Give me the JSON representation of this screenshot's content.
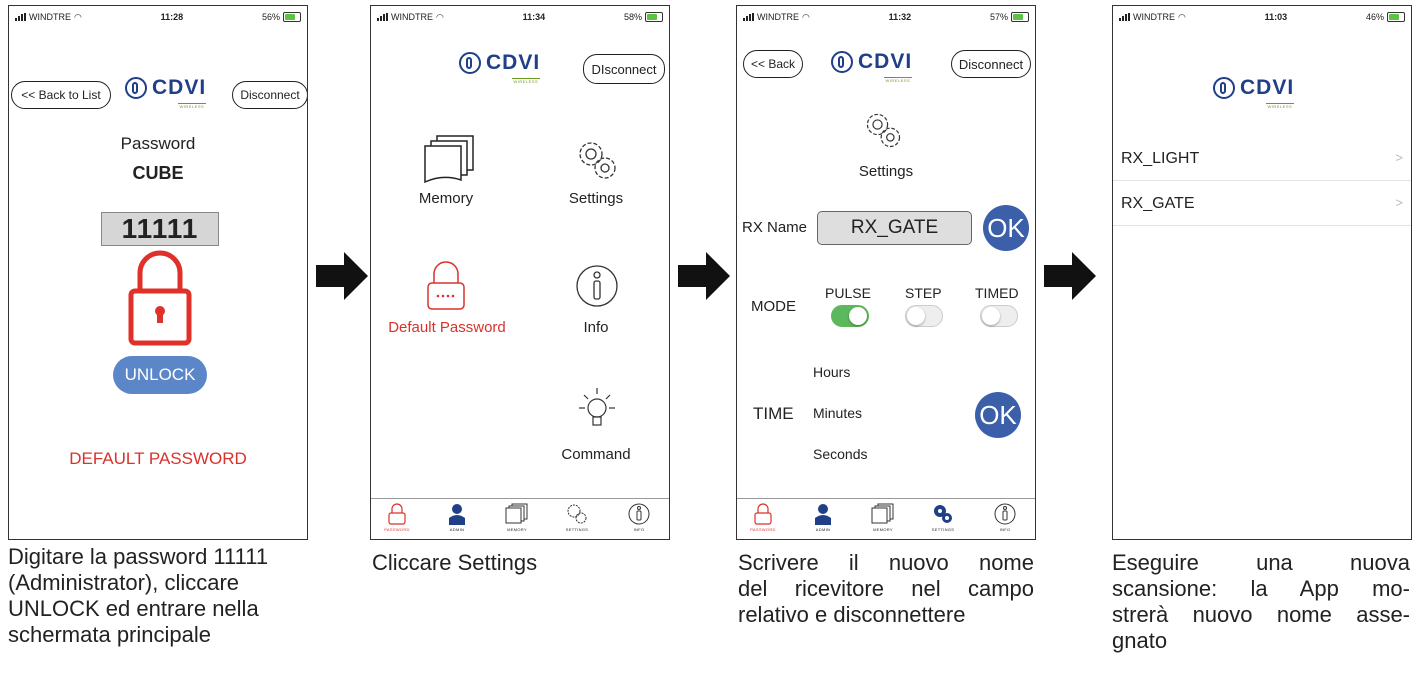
{
  "screen1": {
    "status": {
      "carrier": "WINDTRE",
      "time": "11:28",
      "battery": "56%"
    },
    "back_label": "<< Back to List",
    "disconnect_label": "Disconnect",
    "logo": {
      "name": "CDVI",
      "sub": "WIRELESS"
    },
    "password_label": "Password",
    "device_name": "CUBE",
    "password_value": "11111",
    "unlock_label": "UNLOCK",
    "default_password_label": "DEFAULT PASSWORD",
    "lock_color": "#e0302a"
  },
  "screen2": {
    "status": {
      "carrier": "WINDTRE",
      "time": "11:34",
      "battery": "58%"
    },
    "disconnect_label": "DIsconnect",
    "logo": {
      "name": "CDVI",
      "sub": "WIRELESS"
    },
    "menu": {
      "memory": "Memory",
      "settings": "Settings",
      "default_password": "Default Password",
      "info": "Info",
      "command": "Command"
    },
    "tabs": [
      "PASSWORD",
      "ADMIN",
      "MEMORY",
      "SETTINGS",
      "INFO"
    ]
  },
  "screen3": {
    "status": {
      "carrier": "WINDTRE",
      "time": "11:32",
      "battery": "57%"
    },
    "back_label": "<< Back",
    "disconnect_label": "Disconnect",
    "logo": {
      "name": "CDVI",
      "sub": "WIRELESS"
    },
    "settings_title": "Settings",
    "rx_name_label": "RX Name",
    "rx_name_value": "RX_GATE",
    "ok_label": "OK",
    "mode_label": "MODE",
    "modes": {
      "pulse": "PULSE",
      "step": "STEP",
      "timed": "TIMED"
    },
    "mode_states": {
      "pulse": true,
      "step": false,
      "timed": false
    },
    "time_label": "TIME",
    "time_units": {
      "hours": "Hours",
      "minutes": "Minutes",
      "seconds": "Seconds"
    },
    "tabs": [
      "PASSWORD",
      "ADMIN",
      "MEMORY",
      "SETTINGS",
      "INFO"
    ]
  },
  "screen4": {
    "status": {
      "carrier": "WINDTRE",
      "time": "11:03",
      "battery": "46%"
    },
    "logo": {
      "name": "CDVI",
      "sub": "WIRELESS"
    },
    "devices": [
      "RX_LIGHT",
      "RX_GATE"
    ],
    "chevron": ">"
  },
  "captions": {
    "c1": [
      "Digitare la password 11111",
      "(Administrator), cliccare",
      "UNLOCK ed entrare nella",
      "schermata principale"
    ],
    "c2": [
      "Cliccare Settings"
    ],
    "c3": [
      "Scrivere il nuovo nome",
      "del ricevitore nel campo",
      "relativo e disconnettere"
    ],
    "c4": [
      "Eseguire una nuova",
      "scansione: la App mo-",
      "strerà nuovo nome asse-",
      "gnato"
    ]
  },
  "colors": {
    "accent_blue": "#3b5fa8",
    "brand_blue": "#1f3f88",
    "alert_red": "#e0302a",
    "toggle_green": "#5cb85c"
  }
}
